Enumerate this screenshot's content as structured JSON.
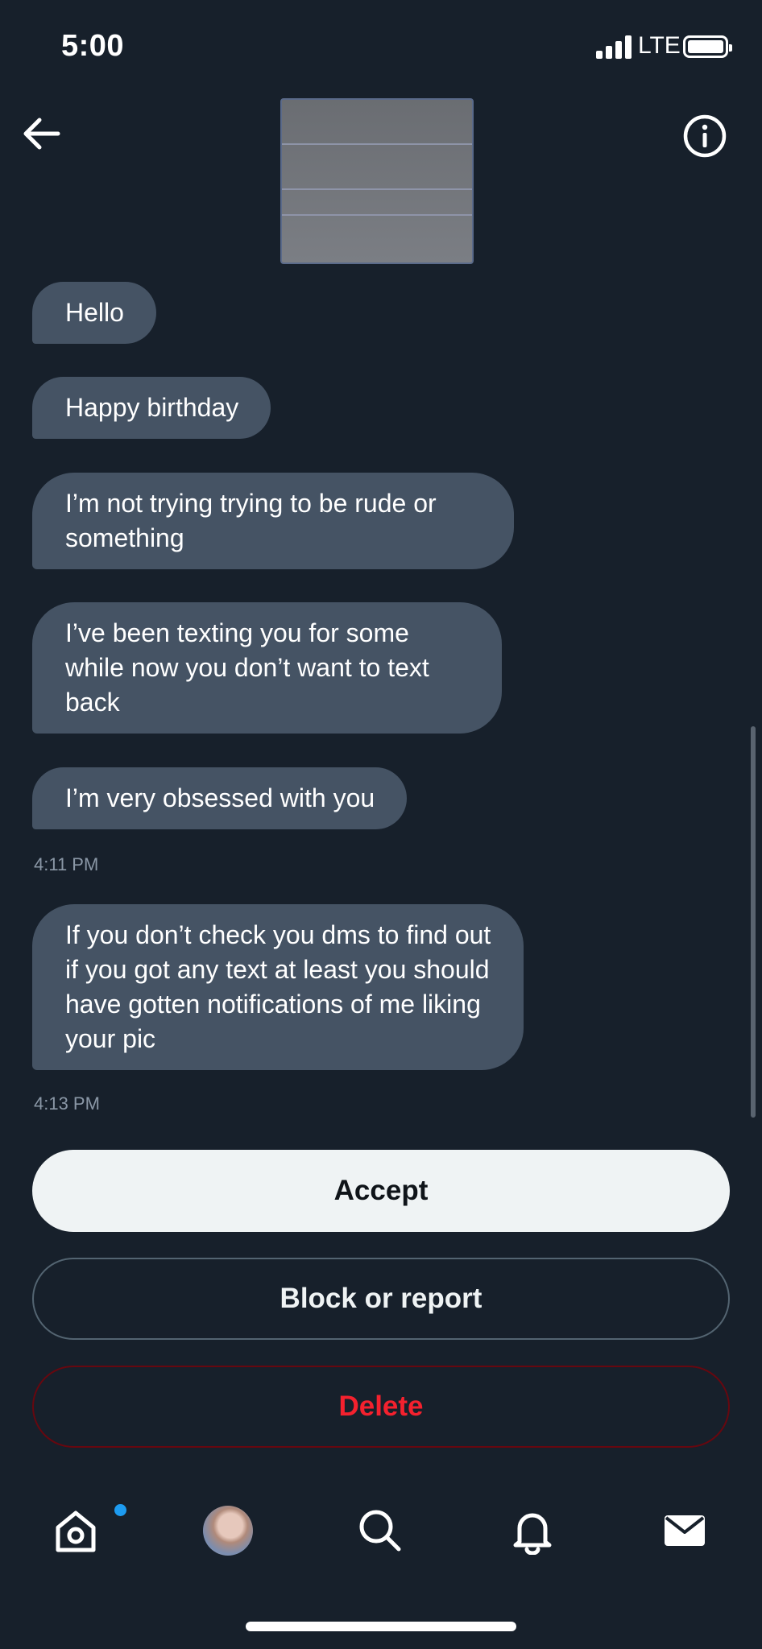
{
  "status_bar": {
    "time": "5:00",
    "network": "LTE"
  },
  "header": {
    "back_icon": "arrow-left-icon",
    "info_icon": "info-circle-icon"
  },
  "messages": [
    {
      "text": "Hello"
    },
    {
      "text": "Happy birthday"
    },
    {
      "text": "I’m not trying trying to be rude or something"
    },
    {
      "text": "I’ve been texting you for some while now you don’t want to text back"
    },
    {
      "text": "I’m very obsessed with you",
      "timestamp": "4:11 PM"
    },
    {
      "text": "If you don’t check you dms to find out if you got any text at least you should have gotten notifications of me liking your pic",
      "timestamp": "4:13 PM"
    }
  ],
  "actions": {
    "accept_label": "Accept",
    "block_label": "Block or report",
    "delete_label": "Delete"
  },
  "tab_bar": {
    "items": [
      "home-icon",
      "profile-avatar",
      "search-icon",
      "bell-icon",
      "mail-icon"
    ],
    "home_has_notification": true
  },
  "colors": {
    "background": "#17202b",
    "bubble": "#455364",
    "accent_blue": "#1d9bf0",
    "delete_red": "#f4212e"
  }
}
